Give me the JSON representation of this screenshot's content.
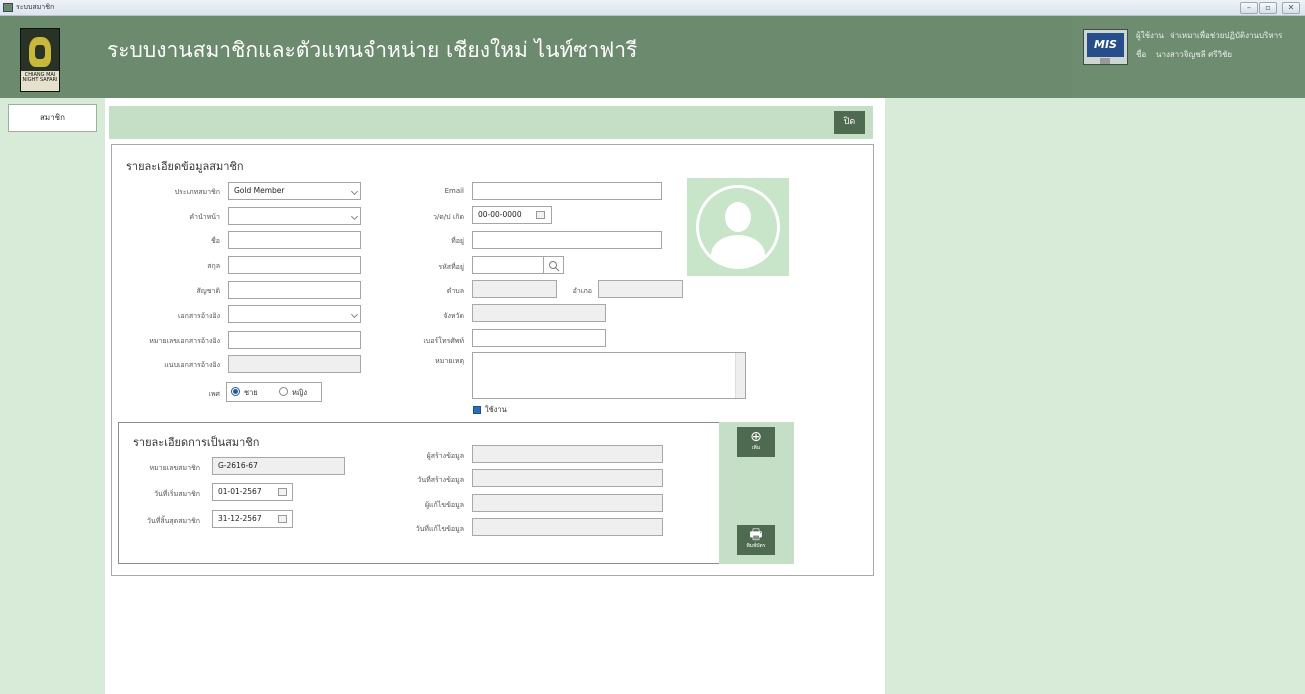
{
  "window": {
    "title": "ระบบสมาชิก",
    "buttons": [
      "–",
      "▫",
      "✕"
    ]
  },
  "header": {
    "title": "ระบบงานสมาชิกและตัวแทนจำหน่าย เชียงใหม่ ไนท์ซาฟารี",
    "logo_text": "CHIANG MAI NIGHT SAFARI",
    "mis_label": "MIS",
    "user_label": "ผู้ใช้งาน",
    "user_role": "จ่าเหมาเพื่อช่วยปฏิบัติงานบริหาร",
    "name_label": "ชื่อ",
    "user_name": "นางสาวจิญชลี ศรีวิชัย"
  },
  "sidebar": {
    "members_button": "สมาชิก"
  },
  "toolbar": {
    "close_button": "ปิด"
  },
  "member_detail": {
    "section_title": "รายละเอียดข้อมูลสมาชิก",
    "fields": {
      "member_type": {
        "label": "ประเภทสมาชิก",
        "value": "Gold Member"
      },
      "title": {
        "label": "คำนำหน้า",
        "value": ""
      },
      "first_name": {
        "label": "ชื่อ",
        "value": ""
      },
      "last_name": {
        "label": "สกุล",
        "value": ""
      },
      "nationality": {
        "label": "สัญชาติ",
        "value": ""
      },
      "ref_doc": {
        "label": "เอกสารอ้างอิง",
        "value": ""
      },
      "ref_doc_no": {
        "label": "หมายเลขเอกสารอ้างอิง",
        "value": ""
      },
      "ref_doc_attach": {
        "label": "แนบเอกสารอ้างอิง",
        "value": ""
      },
      "gender": {
        "label": "เพศ",
        "options": [
          "ชาย",
          "หญิง"
        ],
        "selected": "ชาย"
      },
      "email": {
        "label": "Email",
        "value": ""
      },
      "birthdate": {
        "label": "ว/ด/ป เกิด",
        "value": "00-00-0000"
      },
      "address": {
        "label": "ที่อยู่",
        "value": ""
      },
      "postcode": {
        "label": "รหัสที่อยู่",
        "value": ""
      },
      "subdistrict": {
        "label": "ตำบล",
        "value": ""
      },
      "district": {
        "label": "อำเภอ",
        "value": ""
      },
      "province": {
        "label": "จังหวัด",
        "value": ""
      },
      "phone": {
        "label": "เบอร์โทรศัพท์",
        "value": ""
      },
      "note": {
        "label": "หมายเหตุ",
        "value": ""
      }
    },
    "active_checkbox": {
      "label": "ใช้งาน",
      "checked": true
    }
  },
  "membership": {
    "section_title": "รายละเอียดการเป็นสมาชิก",
    "member_no": {
      "label": "หมายเลขสมาชิก",
      "value": "G-2616-67"
    },
    "start_date": {
      "label": "วันที่เริ่มสมาชิก",
      "value": "01-01-2567"
    },
    "end_date": {
      "label": "วันที่สิ้นสุดสมาชิก",
      "value": "31-12-2567"
    },
    "created_by": {
      "label": "ผู้สร้างข้อมูล",
      "value": ""
    },
    "created_date": {
      "label": "วันที่สร้างข้อมูล",
      "value": ""
    },
    "modified_by": {
      "label": "ผู้แก้ไขข้อมูล",
      "value": ""
    },
    "modified_date": {
      "label": "วันที่แก้ไขข้อมูล",
      "value": ""
    },
    "add_button": "เพิ่ม",
    "print_button": "พิมพ์บัตร"
  },
  "colors": {
    "header": "#6b8a6e",
    "accent_dark": "#4e6b51",
    "light_green": "#d8ebd9",
    "bar_green": "#c5dfc6"
  }
}
